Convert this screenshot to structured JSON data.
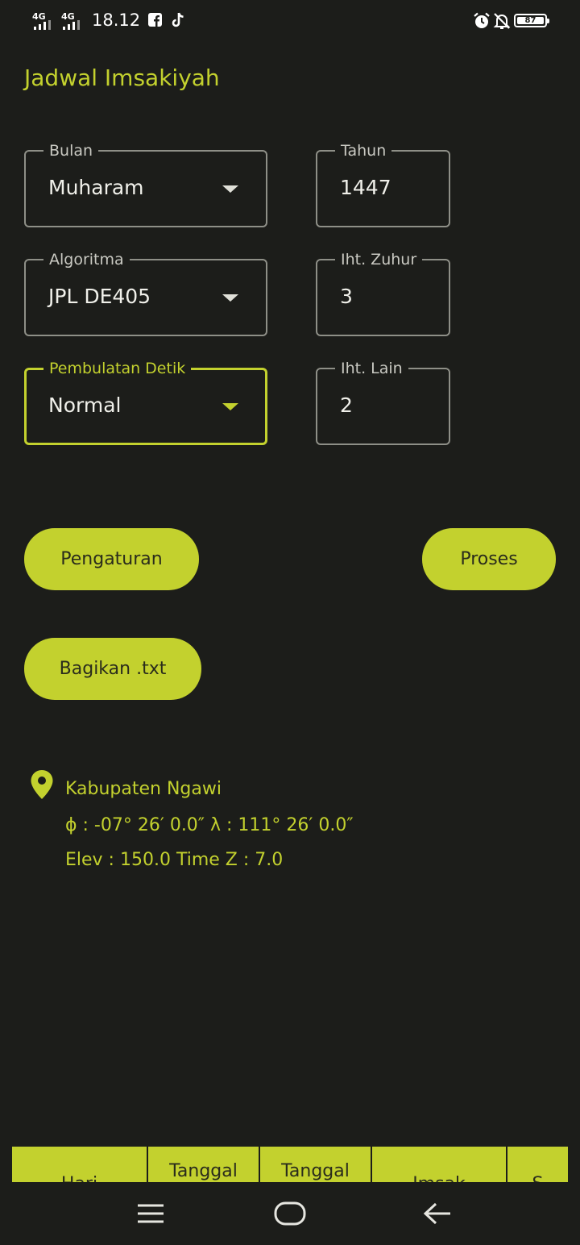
{
  "status_bar": {
    "network_1": "4G",
    "network_2": "4G",
    "time": "18.12",
    "battery": "87"
  },
  "app": {
    "title": "Jadwal Imsakiyah"
  },
  "form": {
    "bulan": {
      "label": "Bulan",
      "value": "Muharam"
    },
    "tahun": {
      "label": "Tahun",
      "value": "1447"
    },
    "algoritma": {
      "label": "Algoritma",
      "value": "JPL DE405"
    },
    "iht_zuhur": {
      "label": "Iht. Zuhur",
      "value": "3"
    },
    "pembulatan": {
      "label": "Pembulatan Detik",
      "value": "Normal"
    },
    "iht_lain": {
      "label": "Iht. Lain",
      "value": "2"
    }
  },
  "buttons": {
    "pengaturan": "Pengaturan",
    "proses": "Proses",
    "bagikan": "Bagikan .txt"
  },
  "location": {
    "name": "Kabupaten Ngawi",
    "coords": "ϕ : -07° 26′ 0.0″  λ : 111° 26′ 0.0″",
    "elev_tz": "Elev : 150.0   Time Z : 7.0"
  },
  "table_headers": [
    "Hari",
    "Tanggal",
    "Tanggal",
    "Imsak",
    "S"
  ],
  "colors": {
    "accent": "#c3d12e",
    "background": "#1c1d1a",
    "outline": "#8e8f87"
  }
}
